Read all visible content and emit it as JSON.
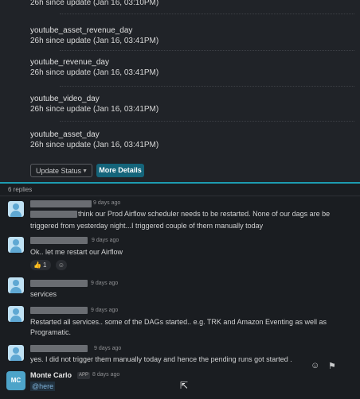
{
  "tables": [
    {
      "name": "",
      "update": "26h since update (Jan 16, 03:10PM)"
    },
    {
      "name": "youtube_asset_revenue_day",
      "update": "26h since update (Jan 16, 03:41PM)"
    },
    {
      "name": "youtube_revenue_day",
      "update": "26h since update (Jan 16, 03:41PM)"
    },
    {
      "name": "youtube_video_day",
      "update": "26h since update (Jan 16, 03:41PM)"
    },
    {
      "name": "youtube_asset_day",
      "update": "26h since update (Jan 16, 03:41PM)"
    }
  ],
  "buttons": {
    "update_status": "Update Status",
    "more_details": "More Details"
  },
  "thread": {
    "replies_count": "6 replies",
    "messages": [
      {
        "time": "9 days ago",
        "lines": [
          "think our Prod Airflow scheduler needs to be restarted. None of our dags are be",
          "triggered from yesterday night...I triggered couple of them manually today"
        ]
      },
      {
        "time": "9 days ago",
        "lines": [
          "Ok.. let me restart our Airflow"
        ],
        "reaction": {
          "emoji": "👍",
          "count": "1"
        }
      },
      {
        "time": "9 days ago",
        "lines": [
          "services"
        ]
      },
      {
        "time": "9 days ago",
        "lines": [
          "Restarted all services.. some of the DAGs started.. e.g. TRK and Amazon Eventing as well as",
          "Programatic."
        ]
      },
      {
        "time": "9 days ago",
        "lines": [
          "yes. I did not trigger them manually today and hence the pending runs got started ."
        ]
      }
    ],
    "last": {
      "avatar": "MC",
      "name": "Monte Carlo",
      "badge": "APP",
      "time": "8 days ago",
      "text": "@here"
    }
  },
  "colors": {
    "accent": "#1d9bb0",
    "button": "#14647a",
    "background": "#1a1d21"
  }
}
